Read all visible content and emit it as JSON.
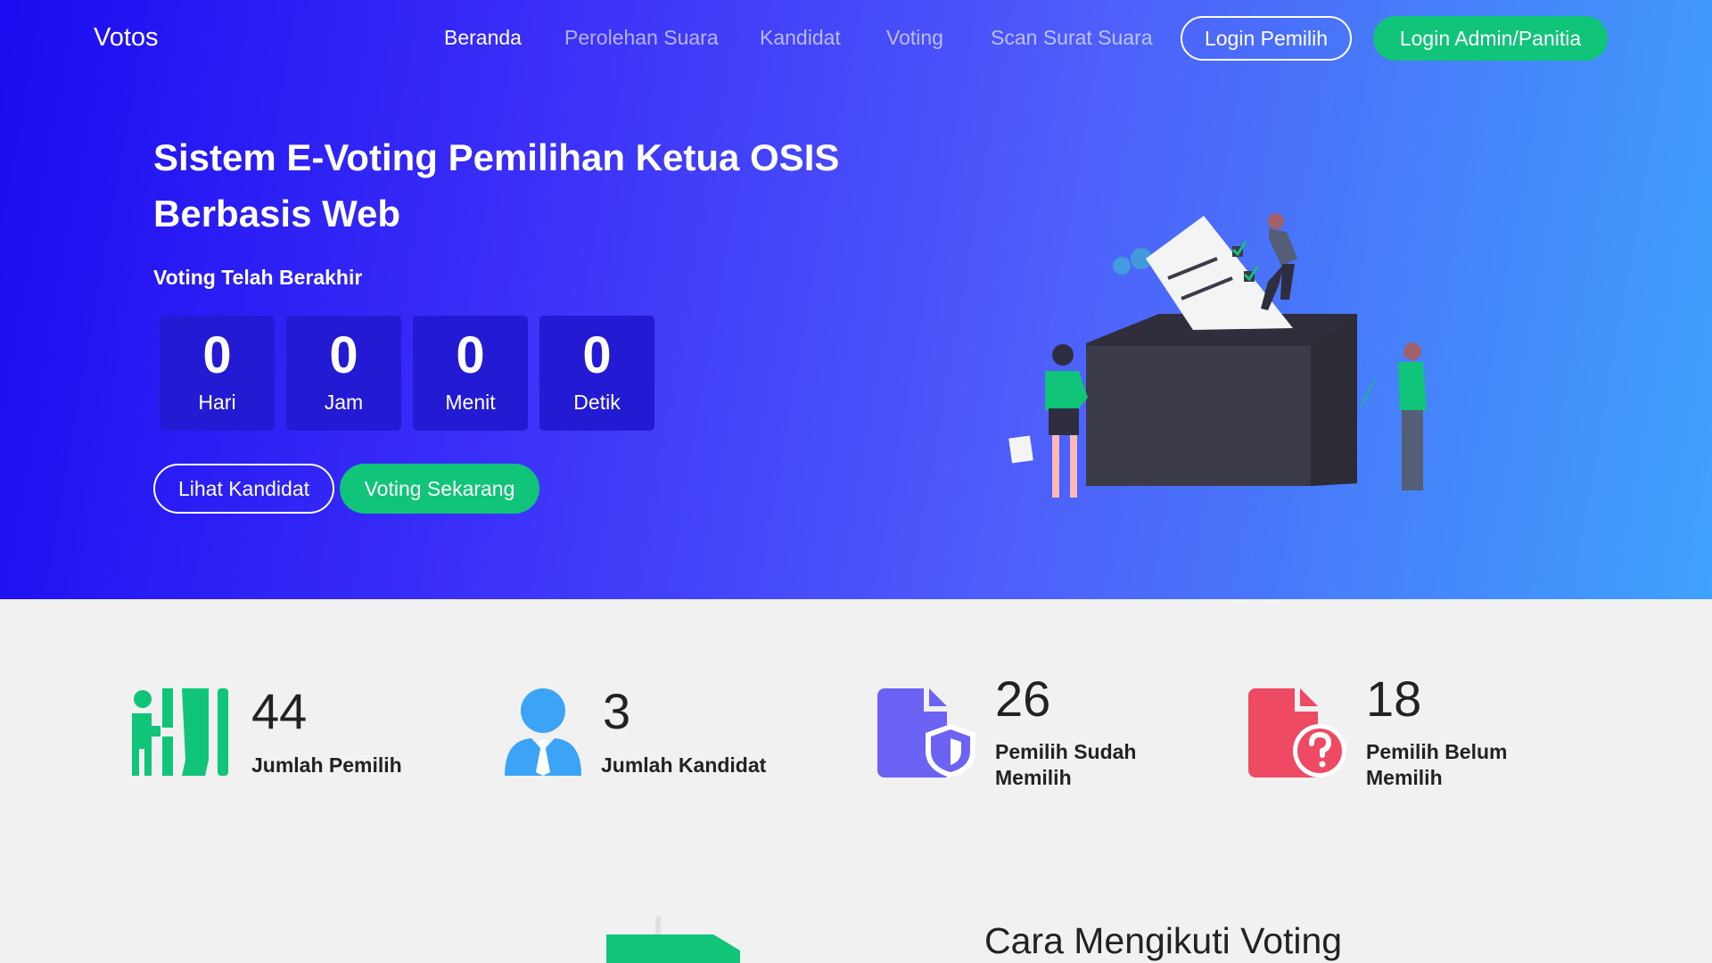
{
  "nav": {
    "brand": "Votos",
    "links": [
      "Beranda",
      "Perolehan Suara",
      "Kandidat",
      "Voting",
      "Scan Surat Suara"
    ],
    "login_pemilih": "Login Pemilih",
    "login_admin": "Login Admin/Panitia"
  },
  "hero": {
    "title_line1": "Sistem E-Voting Pemilihan Ketua OSIS",
    "title_line2": "Berbasis Web",
    "status": "Voting Telah Berakhir",
    "countdown": [
      {
        "value": "0",
        "label": "Hari"
      },
      {
        "value": "0",
        "label": "Jam"
      },
      {
        "value": "0",
        "label": "Menit"
      },
      {
        "value": "0",
        "label": "Detik"
      }
    ],
    "btn_kandidat": "Lihat Kandidat",
    "btn_voting": "Voting Sekarang"
  },
  "stats": [
    {
      "value": "44",
      "label": "Jumlah Pemilih",
      "icon": "voters-icon",
      "color": "#10c47a"
    },
    {
      "value": "3",
      "label": "Jumlah Kandidat",
      "icon": "candidate-icon",
      "color": "#3ba4f6"
    },
    {
      "value": "26",
      "label_line1": "Pemilih Sudah",
      "label_line2": "Memilih",
      "icon": "document-shield-icon",
      "color": "#6c63f5"
    },
    {
      "value": "18",
      "label_line1": "Pemilih Belum",
      "label_line2": "Memilih",
      "icon": "document-question-icon",
      "color": "#ef4a63"
    }
  ],
  "how_to": {
    "title": "Cara Mengikuti Voting"
  },
  "colors": {
    "accent_green": "#10c47a",
    "hero_gradient_start": "#1a0cf0",
    "hero_gradient_end": "#3fa2fb",
    "countdown_bg": "#221bd3"
  }
}
